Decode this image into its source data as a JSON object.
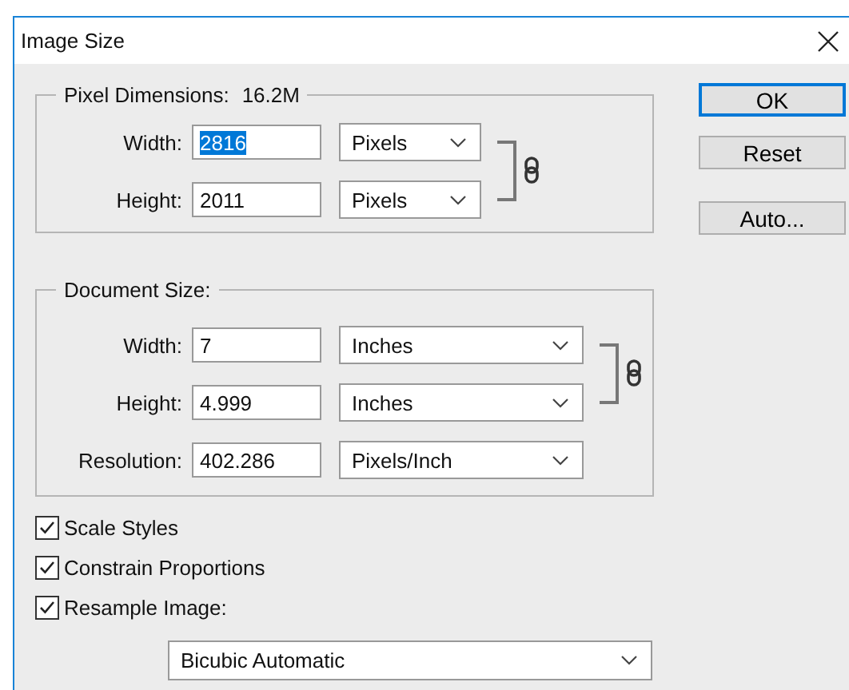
{
  "window": {
    "title": "Image Size"
  },
  "pixel_dimensions": {
    "label": "Pixel Dimensions:",
    "value": "16.2M",
    "rows": [
      {
        "label": "Width:",
        "value": "2816",
        "highlighted": true,
        "unit": "Pixels"
      },
      {
        "label": "Height:",
        "value": "2011",
        "highlighted": false,
        "unit": "Pixels"
      }
    ]
  },
  "document_size": {
    "label": "Document Size:",
    "rows": [
      {
        "label": "Width:",
        "value": "7",
        "highlighted": false,
        "unit": "Inches"
      },
      {
        "label": "Height:",
        "value": "4.999",
        "highlighted": false,
        "unit": "Inches"
      },
      {
        "label": "Resolution:",
        "value": "402.286",
        "highlighted": false,
        "unit": "Pixels/Inch"
      }
    ]
  },
  "checkboxes": [
    {
      "label": "Scale Styles",
      "checked": true
    },
    {
      "label": "Constrain Proportions",
      "checked": true
    },
    {
      "label": "Resample Image:",
      "checked": true
    }
  ],
  "resample_method": "Bicubic Automatic",
  "buttons": [
    {
      "label": "OK",
      "default": true
    },
    {
      "label": "Reset",
      "default": false
    },
    {
      "label": "Auto...",
      "default": false
    }
  ]
}
